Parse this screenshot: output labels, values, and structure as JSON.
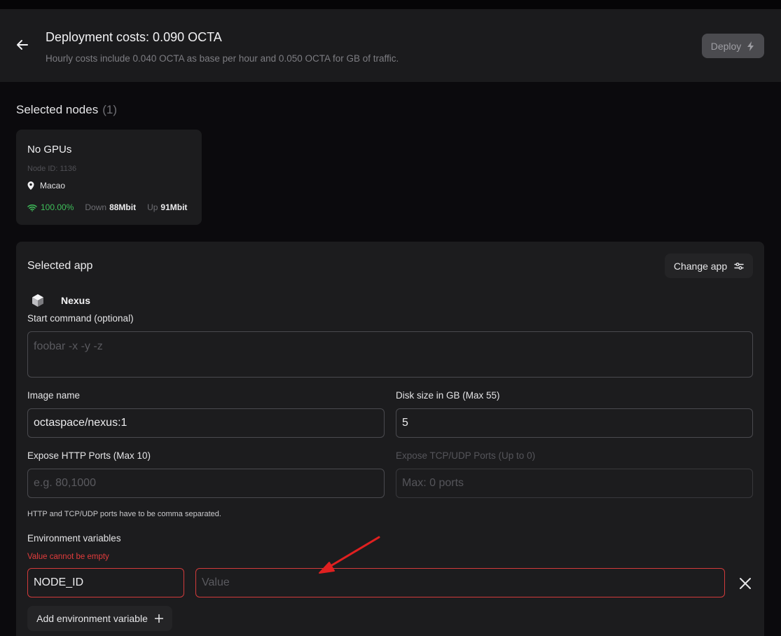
{
  "header": {
    "title": "Deployment costs: 0.090 OCTA",
    "subtitle": "Hourly costs include 0.040 OCTA as base per hour and 0.050 OCTA for GB of traffic.",
    "deploy_label": "Deploy"
  },
  "nodes": {
    "title": "Selected nodes",
    "count": "(1)",
    "card": {
      "name": "No GPUs",
      "node_id": "Node ID: 1136",
      "location": "Macao",
      "uptime": "100.00%",
      "down_label": "Down",
      "down_value": "88Mbit",
      "up_label": "Up",
      "up_value": "91Mbit"
    }
  },
  "app": {
    "title": "Selected app",
    "change_label": "Change app",
    "name": "Nexus",
    "start_command": {
      "label": "Start command (optional)",
      "placeholder": "foobar -x -y -z"
    },
    "image_name": {
      "label": "Image name",
      "value": "octaspace/nexus:1"
    },
    "disk_size": {
      "label": "Disk size in GB (Max 55)",
      "value": "5"
    },
    "http_ports": {
      "label": "Expose HTTP Ports (Max 10)",
      "placeholder": "e.g. 80,1000"
    },
    "tcp_ports": {
      "label": "Expose TCP/UDP Ports (Up to 0)",
      "placeholder": "Max: 0 ports"
    },
    "ports_hint": "HTTP and TCP/UDP ports have to be comma separated.",
    "env": {
      "label": "Environment variables",
      "error": "Value cannot be empty",
      "key_value": "NODE_ID",
      "value_placeholder": "Value",
      "add_label": "Add environment variable"
    }
  },
  "colors": {
    "accent_green": "#3fbf5a",
    "error_red": "#d23b3b",
    "annotation_arrow": "#e02020"
  }
}
